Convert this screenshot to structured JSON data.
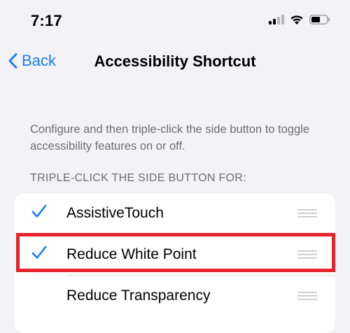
{
  "status_bar": {
    "time": "7:17",
    "icons": [
      "cellular-signal-icon",
      "wifi-icon",
      "battery-icon"
    ]
  },
  "nav": {
    "back_label": "Back",
    "title": "Accessibility Shortcut"
  },
  "description": "Configure and then triple-click the side button to toggle accessibility features on or off.",
  "section_header": "TRIPLE-CLICK THE SIDE BUTTON FOR:",
  "items": [
    {
      "label": "AssistiveTouch",
      "checked": true
    },
    {
      "label": "Reduce White Point",
      "checked": true,
      "highlighted": true
    },
    {
      "label": "Reduce Transparency",
      "checked": false
    }
  ],
  "colors": {
    "accent": "#1a7cf3",
    "background": "#f2f2f7",
    "secondary_text": "#6d6d72",
    "highlight_box": "#e8222b"
  }
}
